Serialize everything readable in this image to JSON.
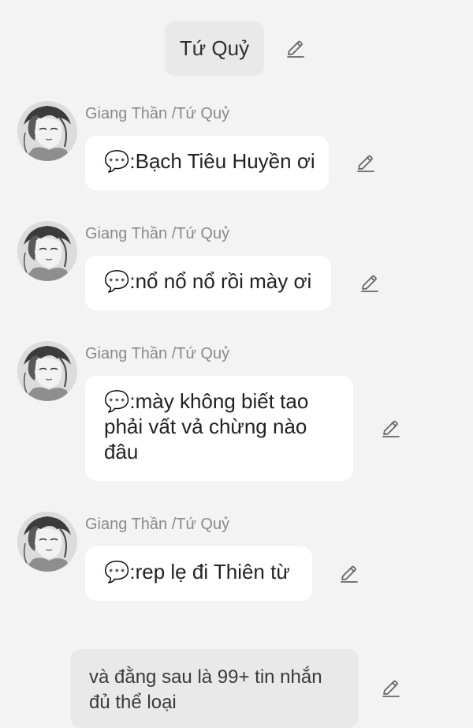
{
  "header": {
    "label": "Tứ Quỷ",
    "edit_icon": "pencil-icon"
  },
  "messages": [
    {
      "sender": "Giang Thần /Tứ Quỷ",
      "lines": [
        "💬:Bạch Tiêu Huyền ơi"
      ],
      "avatar_icon": "sketch-portrait-avatar",
      "edit_icon": "pencil-icon"
    },
    {
      "sender": "Giang Thần /Tứ Quỷ",
      "lines": [
        "💬:nổ nổ nổ rồi mày ơi"
      ],
      "avatar_icon": "sketch-portrait-avatar",
      "edit_icon": "pencil-icon"
    },
    {
      "sender": "Giang Thần /Tứ Quỷ",
      "lines": [
        "💬:mày không biết tao",
        "phải vất vả chừng nào",
        "đâu"
      ],
      "avatar_icon": "sketch-portrait-avatar",
      "edit_icon": "pencil-icon"
    },
    {
      "sender": "Giang Thần /Tứ Quỷ",
      "lines": [
        "💬:rep lẹ đi Thiên từ"
      ],
      "avatar_icon": "sketch-portrait-avatar",
      "edit_icon": "pencil-icon"
    }
  ],
  "footer": {
    "lines": [
      "và đằng sau là 99+ tin nhắn",
      "đủ thể loại"
    ],
    "edit_icon": "pencil-icon"
  },
  "colors": {
    "background": "#f3f3f3",
    "bubble": "#ffffff",
    "system_bubble": "#e9e9e9",
    "sender_text": "#8a8a8a",
    "message_text": "#222222",
    "icon_stroke": "#666666"
  }
}
